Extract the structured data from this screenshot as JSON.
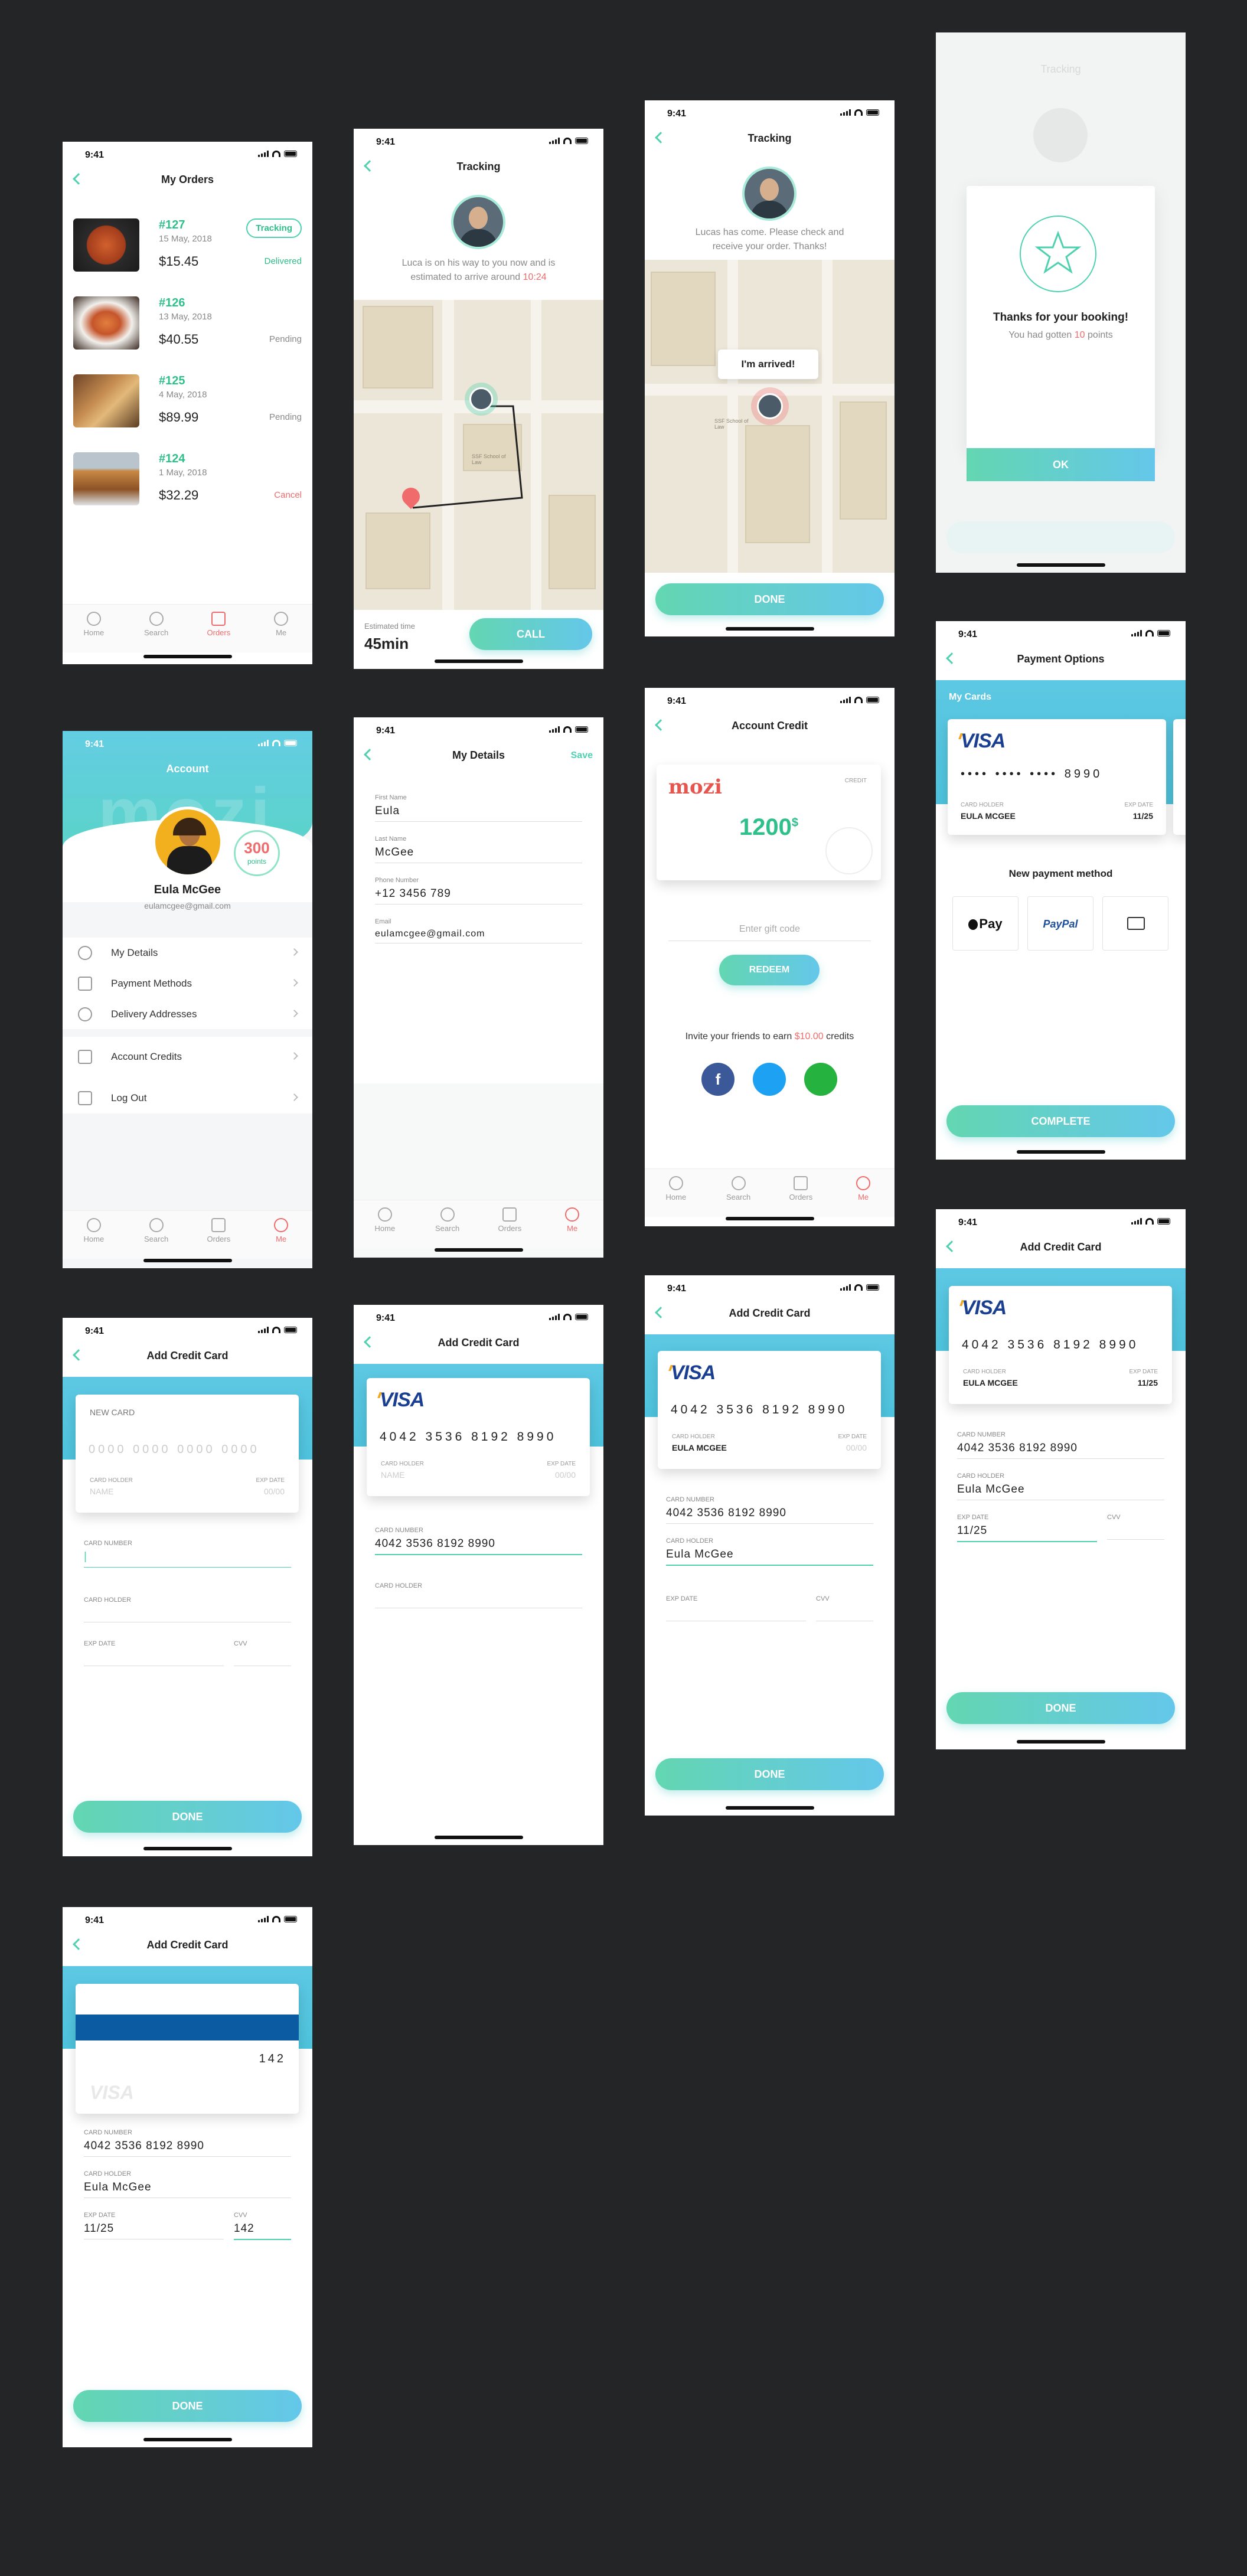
{
  "status_time": "9:41",
  "tabs": [
    "Home",
    "Search",
    "Orders",
    "Me"
  ],
  "my_orders": {
    "title": "My Orders",
    "orders": [
      {
        "num": "#127",
        "date": "15 May, 2018",
        "price": "$15.45",
        "status": "Delivered",
        "badge": "Tracking"
      },
      {
        "num": "#126",
        "date": "13 May, 2018",
        "price": "$40.55",
        "status": "Pending"
      },
      {
        "num": "#125",
        "date": "4 May, 2018",
        "price": "$89.99",
        "status": "Pending"
      },
      {
        "num": "#124",
        "date": "1 May, 2018",
        "price": "$32.29",
        "status": "Cancel"
      }
    ]
  },
  "tracking1": {
    "title": "Tracking",
    "message": "Luca is on his way to you now and is estimated to arrive around",
    "eta_time": "10:24",
    "est_label": "Estimated time",
    "est_value": "45min",
    "call": "CALL",
    "map_label": "SSF School of Law"
  },
  "tracking2": {
    "title": "Tracking",
    "message": "Lucas has come. Please check and receive your order. Thanks!",
    "arrived": "I'm arrived!",
    "done": "DONE",
    "map_label": "SSF School of Law"
  },
  "booking": {
    "bg_title": "Tracking",
    "title": "Thanks for your booking!",
    "points_pre": "You had gotten",
    "points_num": "10",
    "points_post": "points",
    "ok": "OK"
  },
  "account": {
    "title": "Account",
    "name": "Eula McGee",
    "email": "eulamcgee@gmail.com",
    "points": "300",
    "points_label": "points",
    "watermark": "mozi",
    "menu": [
      "My Details",
      "Payment Methods",
      "Delivery Addresses",
      "Account Credits",
      "Log Out"
    ]
  },
  "details": {
    "title": "My Details",
    "save": "Save",
    "fields": [
      {
        "label": "First Name",
        "value": "Eula"
      },
      {
        "label": "Last Name",
        "value": "McGee"
      },
      {
        "label": "Phone Number",
        "value": "+12 3456 789"
      },
      {
        "label": "Email",
        "value": "eulamcgee@gmail.com"
      }
    ]
  },
  "credit": {
    "title": "Account Credit",
    "brand": "mozi",
    "tag": "CREDIT",
    "amount": "1200",
    "currency": "$",
    "gift_placeholder": "Enter gift code",
    "redeem": "REDEEM",
    "invite_pre": "Invite your friends to earn",
    "invite_amount": "$10.00",
    "invite_post": "credits"
  },
  "payment": {
    "title": "Payment Options",
    "my_cards": "My Cards",
    "card_number": "•••• •••• •••• 8990",
    "holder_label": "CARD HOLDER",
    "holder": "EULA MCGEE",
    "exp_label": "EXP DATE",
    "exp": "11/25",
    "new_method": "New payment method",
    "apple": "Pay",
    "paypal": "PayPal",
    "complete": "COMPLETE"
  },
  "add_card": {
    "title": "Add Credit Card",
    "new_card": "NEW CARD",
    "num_placeholder": "0000 0000 0000 0000",
    "holder_label": "CARD HOLDER",
    "name_placeholder": "NAME",
    "exp_label": "EXP DATE",
    "exp_placeholder": "00/00",
    "card_number_label": "CARD NUMBER",
    "cvv_label": "CVV",
    "number": "4042 3536 8192 8990",
    "holder_upper": "EULA MCGEE",
    "holder_name": "Eula McGee",
    "exp": "11/25",
    "cvv": "142",
    "visa": "VISA",
    "done": "DONE"
  }
}
